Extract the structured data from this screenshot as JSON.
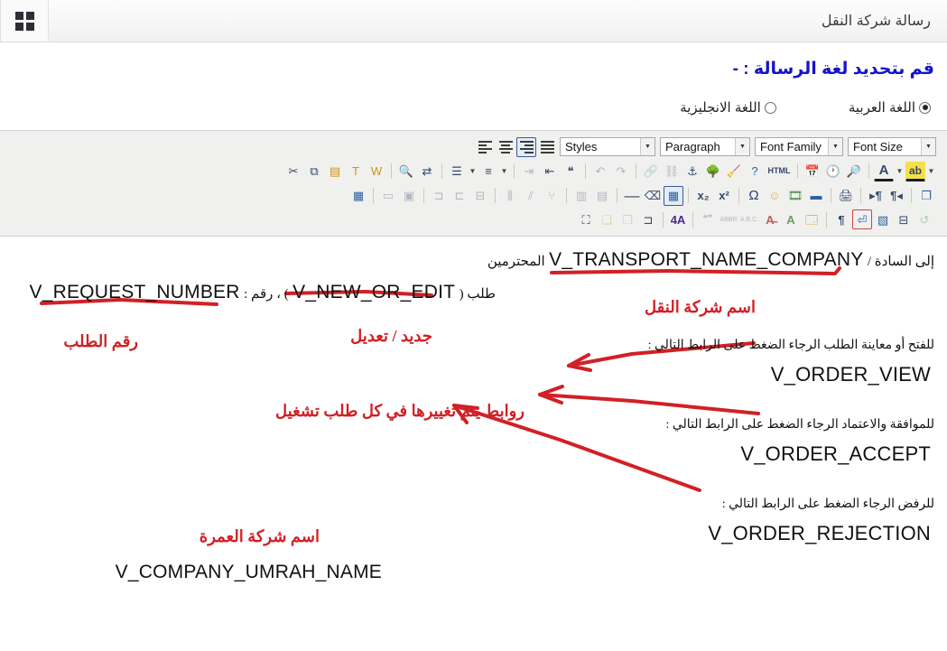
{
  "topbar": {
    "title": "رسالة شركة النقل",
    "grid_icon": "apps-grid-icon"
  },
  "language_section": {
    "heading": "قم بتحديد لغة الرسالة : -",
    "options": [
      {
        "label": "اللغة العربية",
        "selected": true
      },
      {
        "label": "اللغة الانجليزية",
        "selected": false
      }
    ]
  },
  "editor_toolbar": {
    "selects": [
      {
        "name": "styles",
        "label": "Styles"
      },
      {
        "name": "paragraph",
        "label": "Paragraph"
      },
      {
        "name": "font-family",
        "label": "Font Family"
      },
      {
        "name": "font-size",
        "label": "Font Size"
      }
    ],
    "align_buttons": [
      {
        "name": "align-left",
        "active": false
      },
      {
        "name": "align-center",
        "active": false
      },
      {
        "name": "align-right",
        "active": true
      },
      {
        "name": "align-justify",
        "active": false
      }
    ],
    "row2_icons": [
      "cut-icon",
      "copy-icon",
      "paste-icon",
      "paste-text-icon",
      "paste-word-icon",
      "find-icon",
      "find-replace-icon",
      "bullet-list-icon",
      "numbered-list-icon",
      "outdent-icon",
      "indent-icon",
      "blockquote-icon",
      "undo-icon",
      "redo-icon",
      "link-icon",
      "unlink-icon",
      "anchor-icon",
      "image-icon",
      "cleanup-icon",
      "help-icon",
      "html-icon",
      "insert-date-icon",
      "insert-time-icon",
      "preview-icon",
      "text-color-icon",
      "highlight-color-icon"
    ],
    "row3_icons": [
      "table-properties-icon",
      "row-properties-icon",
      "cell-properties-icon",
      "insert-row-before-icon",
      "insert-row-after-icon",
      "delete-row-icon",
      "insert-column-before-icon",
      "insert-column-after-icon",
      "delete-column-icon",
      "split-cells-icon",
      "merge-cells-icon",
      "horizontal-rule-icon",
      "eraser-icon",
      "table-icon",
      "subscript-icon",
      "superscript-icon",
      "special-character-icon",
      "emoticon-icon",
      "media-icon",
      "page-break-icon",
      "print-icon",
      "ltr-direction-icon",
      "rtl-direction-icon",
      "fullscreen-icon"
    ],
    "row4_icons": [
      "select-all-icon",
      "layer-back-icon",
      "layer-front-icon",
      "move-forward-icon",
      "style-props-icon",
      "citation-icon",
      "abbreviation-icon",
      "acronym-icon",
      "delete-formatting-icon",
      "insert-attribute-icon",
      "visual-aid-icon",
      "paragraph-mark-icon",
      "nonbreaking-icon",
      "template-icon",
      "page-break-layout-icon",
      "restore-icon"
    ]
  },
  "document": {
    "lines": [
      {
        "name": "recipient-line",
        "text_before": "إلى السادة /",
        "variable": "V_TRANSPORT_NAME_COMPANY",
        "text_after": "المحترمين"
      },
      {
        "name": "request-line",
        "prefix": "طلب (",
        "variable1": "V_NEW_OR_EDIT",
        "middle": ") ، رقم :",
        "variable2": "V_REQUEST_NUMBER"
      },
      {
        "name": "view-instruction",
        "text": "للفتح أو معاينة الطلب الرجاء الضغط على الرابط التالي :"
      },
      {
        "name": "view-link",
        "text": "V_ORDER_VIEW"
      },
      {
        "name": "accept-instruction",
        "text": "للموافقة والاعتماد الرجاء الضغط على الرابط التالي :"
      },
      {
        "name": "accept-link",
        "text": "V_ORDER_ACCEPT"
      },
      {
        "name": "reject-instruction",
        "text": "للرفض الرجاء الضغط على الرابط التالي :"
      },
      {
        "name": "reject-link",
        "text": "V_ORDER_REJECTION"
      },
      {
        "name": "umrah-company-name",
        "text": "V_COMPANY_UMRAH_NAME"
      }
    ],
    "annotations": [
      {
        "name": "annotation-transport-company-name",
        "text": "اسم شركة النقل"
      },
      {
        "name": "annotation-new-or-edit",
        "text": "جديد / تعديل"
      },
      {
        "name": "annotation-request-number",
        "text": "رقم الطلب"
      },
      {
        "name": "annotation-changing-links",
        "text": "روابط يتم تغييرها في كل طلب تشغيل"
      },
      {
        "name": "annotation-umrah-company-name",
        "text": "اسم شركة العمرة"
      }
    ],
    "annotation_color": "#d12026"
  }
}
